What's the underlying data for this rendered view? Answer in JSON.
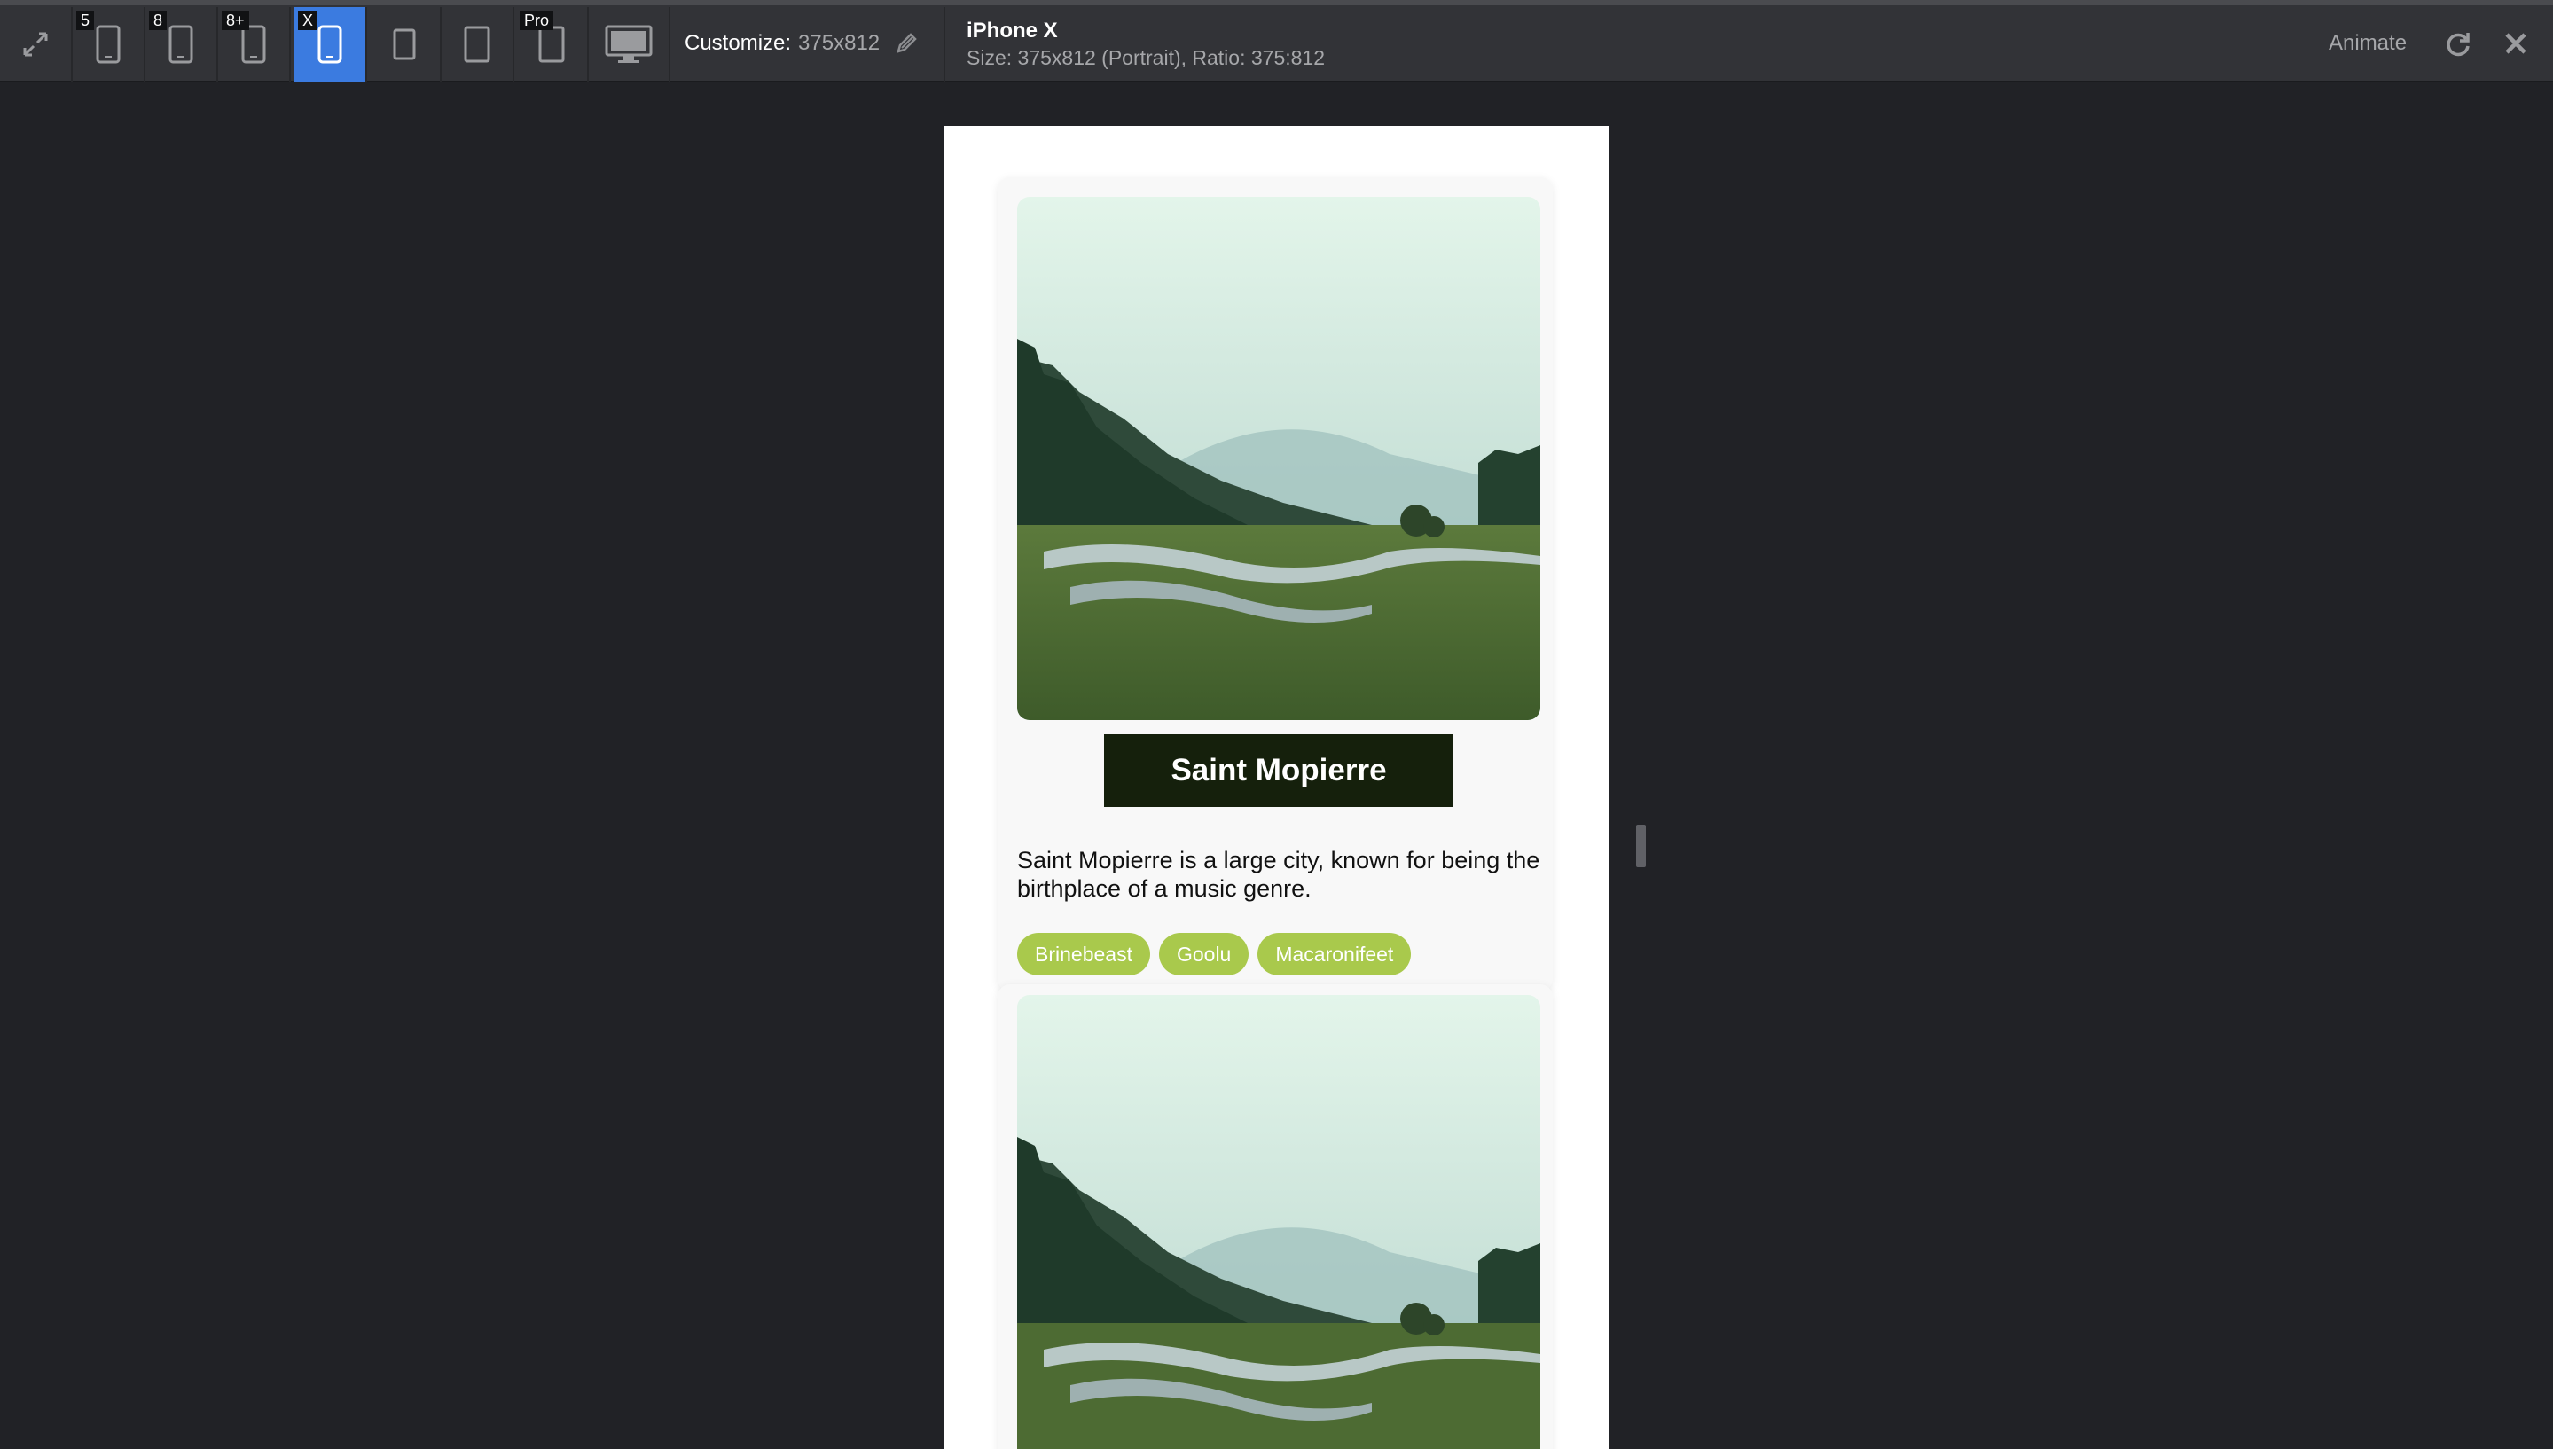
{
  "toolbar": {
    "devices": [
      {
        "badge": "5"
      },
      {
        "badge": "8"
      },
      {
        "badge": "8+"
      },
      {
        "badge": "X"
      },
      {
        "badge": ""
      },
      {
        "badge": ""
      },
      {
        "badge": "Pro"
      }
    ],
    "customize_label": "Customize:",
    "customize_value": "375x812",
    "device_name": "iPhone X",
    "device_size": "Size: 375x812 (Portrait), Ratio: 375:812",
    "animate_label": "Animate",
    "active_color": "#3b7be0"
  },
  "cards": [
    {
      "title": "Saint Mopierre",
      "description": "Saint Mopierre is a large city, known for being the birthplace of a music genre.",
      "tags": [
        "Brinebeast",
        "Goolu",
        "Macaronifeet"
      ]
    },
    {
      "title": "",
      "description": "",
      "tags": []
    }
  ],
  "colors": {
    "title_bg": "#15200c",
    "tag_bg": "#a9c94c"
  }
}
